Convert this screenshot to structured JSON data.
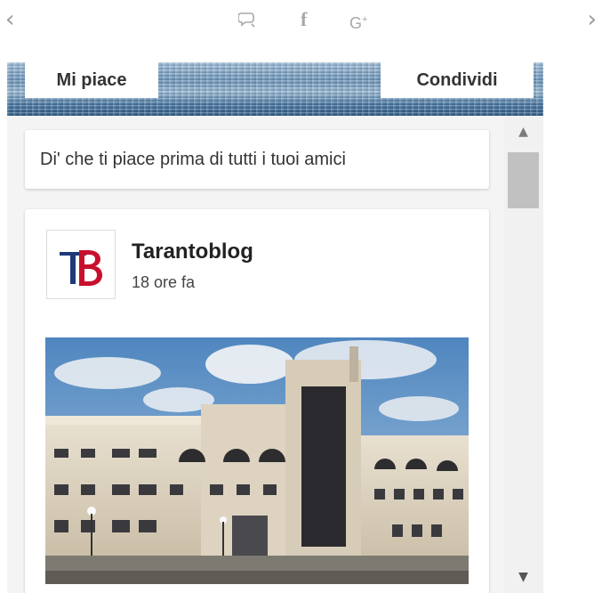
{
  "nav": {
    "prev_icon": "chevron-left-icon",
    "next_icon": "chevron-right-icon",
    "prev_glyph": "‹",
    "next_glyph": "›"
  },
  "social": {
    "comment_icon": "comment-icon",
    "facebook_glyph": "f",
    "gplus_glyph": "G",
    "gplus_plus": "+"
  },
  "header": {
    "like_label": "Mi piace",
    "share_label": "Condividi"
  },
  "feed": {
    "prompt": "Di' che ti piace prima di tutti i tuoi amici",
    "post": {
      "page_name": "Tarantoblog",
      "time": "18 ore fa"
    }
  },
  "scrollbar": {
    "up_glyph": "▲",
    "down_glyph": "▼"
  },
  "colors": {
    "icon_gray": "#a8a8a8",
    "logo_blue": "#1f3a7a",
    "logo_red": "#c8102e"
  }
}
